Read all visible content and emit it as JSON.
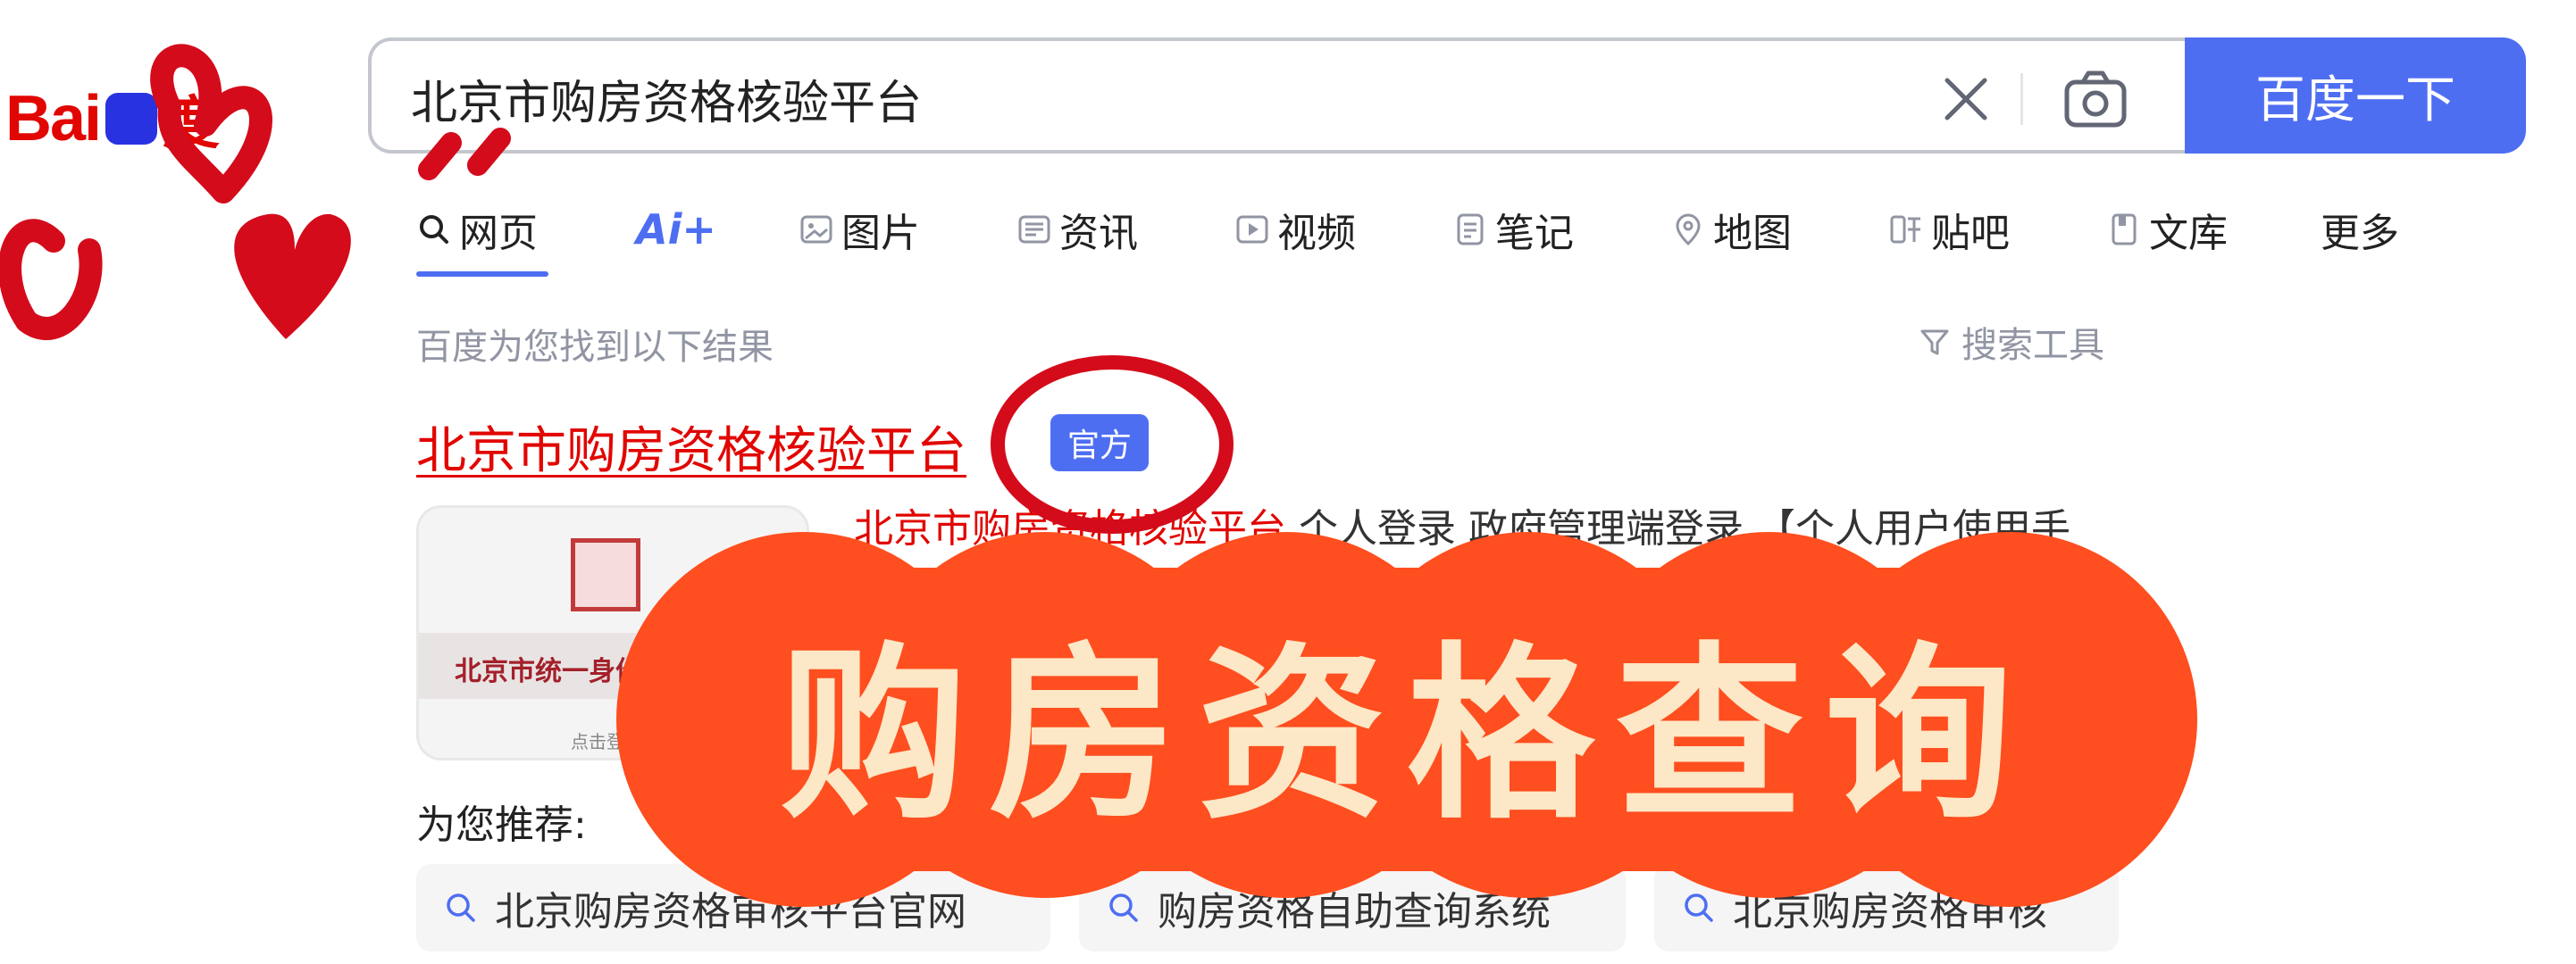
{
  "logo": {
    "text_left": "Bai",
    "text_right": "度"
  },
  "search": {
    "query": "北京市购房资格核验平台",
    "button_label": "百度一下"
  },
  "tabs": [
    {
      "label": "网页",
      "icon": "search-icon"
    },
    {
      "label": "Ai+",
      "icon": "ai-icon"
    },
    {
      "label": "图片",
      "icon": "image-icon"
    },
    {
      "label": "资讯",
      "icon": "news-icon"
    },
    {
      "label": "视频",
      "icon": "video-icon"
    },
    {
      "label": "笔记",
      "icon": "note-icon"
    },
    {
      "label": "地图",
      "icon": "map-icon"
    },
    {
      "label": "贴吧",
      "icon": "tieba-icon"
    },
    {
      "label": "文库",
      "icon": "library-icon"
    },
    {
      "label": "更多",
      "icon": ""
    }
  ],
  "results_meta": {
    "count_text": "百度为您找到以下结果",
    "tools_label": "搜索工具"
  },
  "result": {
    "title": "北京市购房资格核验平台",
    "badge": "官方",
    "thumb_text": "北京市统一身份",
    "thumb_small": "点击登",
    "snippet_highlight": "北京市购房资格核验平台",
    "snippet_rest": " 个人登录 政府管理端登录 【个人用户使用手"
  },
  "recommend": {
    "label": "为您推荐:",
    "items": [
      "北京购房资格审核平台官网",
      "购房资格自助查询系统",
      "北京购房资格审核"
    ]
  },
  "overlay": {
    "banner_text": "购房资格查询"
  },
  "colors": {
    "accent": "#4e6ef2",
    "brand_red": "#e10602",
    "banner": "#ff4e1f",
    "doodle": "#d40b1b"
  }
}
